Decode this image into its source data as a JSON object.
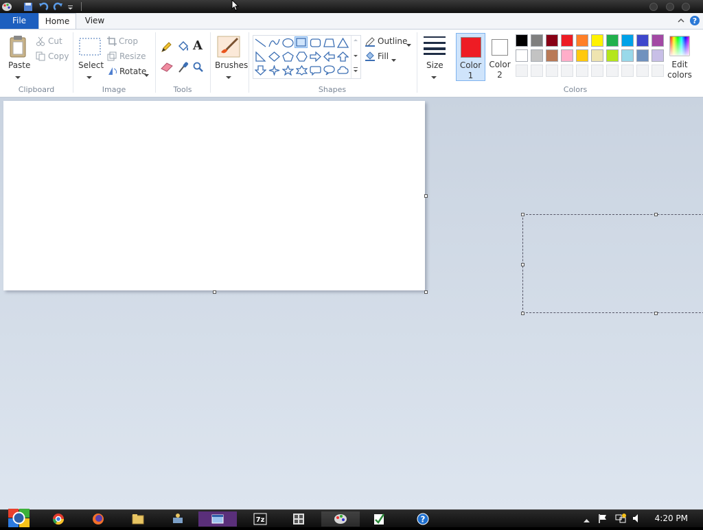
{
  "menu": {
    "file": "File",
    "home": "Home",
    "view": "View"
  },
  "clipboard": {
    "paste": "Paste",
    "cut": "Cut",
    "copy": "Copy",
    "group": "Clipboard"
  },
  "image": {
    "select": "Select",
    "crop": "Crop",
    "resize": "Resize",
    "rotate": "Rotate",
    "group": "Image"
  },
  "tools": {
    "group": "Tools",
    "text_glyph": "A"
  },
  "brushes": {
    "label": "Brushes"
  },
  "shapes": {
    "outline": "Outline",
    "fill": "Fill",
    "group": "Shapes"
  },
  "size": {
    "label": "Size"
  },
  "colors": {
    "color1_line1": "Color",
    "color1_line2": "1",
    "color2_line1": "Color",
    "color2_line2": "2",
    "edit_line1": "Edit",
    "edit_line2": "colors",
    "group": "Colors",
    "color1": "#ee1c24",
    "color2": "#ffffff",
    "palette_row1": [
      "#000000",
      "#7f7f7f",
      "#880015",
      "#ed1c24",
      "#ff7f27",
      "#fff200",
      "#22b14c",
      "#00a2e8",
      "#3f48cc",
      "#a349a4"
    ],
    "palette_row2": [
      "#ffffff",
      "#c3c3c3",
      "#b97a57",
      "#ffaec9",
      "#ffc90e",
      "#efe4b0",
      "#b5e61d",
      "#99d9ea",
      "#7092be",
      "#c8bfe7"
    ]
  },
  "taskbar": {
    "clock": "4:20 PM"
  }
}
